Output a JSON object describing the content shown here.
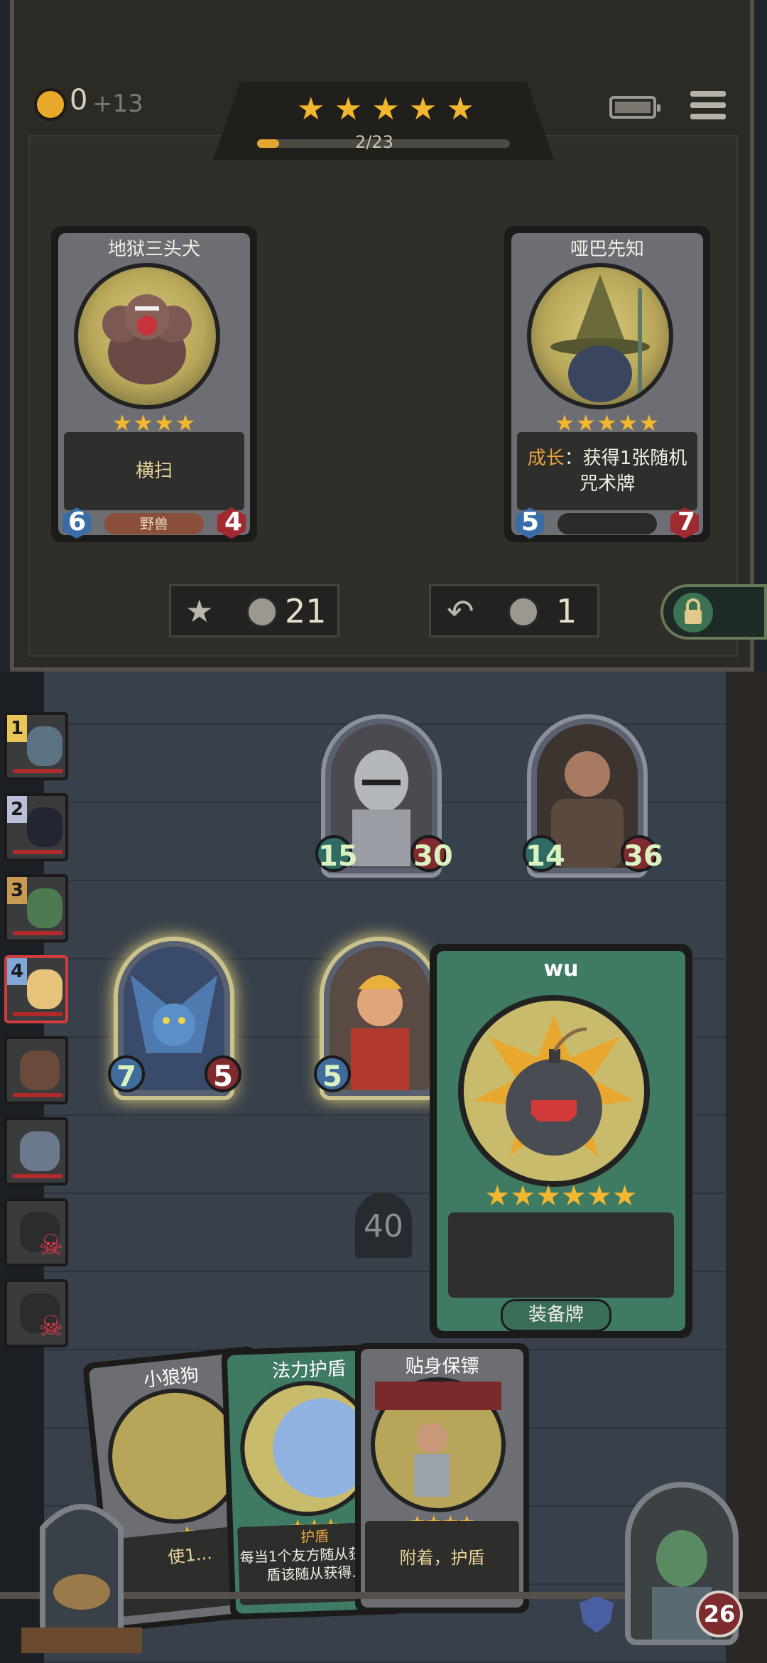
{
  "top": {
    "coins": "0",
    "coin_income": "+13",
    "stars": [
      "★",
      "★",
      "★",
      "★",
      "★"
    ],
    "progress_text": "2/23",
    "progress_fraction": 0.087
  },
  "shop_cards": [
    {
      "title": "地狱三头犬",
      "stars": "★★★★",
      "desc": "横扫",
      "attack": "6",
      "health": "4",
      "tag": "野兽"
    },
    {
      "title": "哑巴先知",
      "stars": "★★★★★",
      "desc_key": "成长",
      "desc": "：获得1张随机咒术牌",
      "attack": "5",
      "health": "7",
      "tag": ""
    }
  ],
  "shop_buttons": {
    "upgrade_cost": "21",
    "refresh_cost": "1"
  },
  "board_enemy": [
    {
      "attack": "15",
      "health": "30"
    },
    {
      "attack": "14",
      "health": "36"
    }
  ],
  "board_player": [
    {
      "attack": "7",
      "health": "5"
    },
    {
      "attack": "5",
      "health": ""
    }
  ],
  "sidebar": [
    {
      "rank": "1"
    },
    {
      "rank": "2"
    },
    {
      "rank": "3"
    },
    {
      "rank": "4"
    },
    {
      "rank": ""
    },
    {
      "rank": ""
    },
    {
      "rank": ""
    },
    {
      "rank": ""
    }
  ],
  "equipment": {
    "title": "wu",
    "stars": "★★★★★★",
    "tag": "装备牌"
  },
  "deck_count": "40",
  "hand": [
    {
      "title": "小狼狗",
      "desc": "使1...",
      "stars": "★"
    },
    {
      "title": "法力护盾",
      "desc_key": "护盾",
      "desc": "每当1个友方随从获得护盾该随从获得...",
      "stars": "★★★"
    },
    {
      "title": "贴身保镖",
      "desc": "附着，护盾",
      "stars": "★★★★"
    }
  ],
  "hero_hp": "26",
  "colors": {
    "gold": "#f2b72e",
    "health": "#7f2a2f",
    "attack": "#2f6b62",
    "equip": "#3f7a63"
  }
}
